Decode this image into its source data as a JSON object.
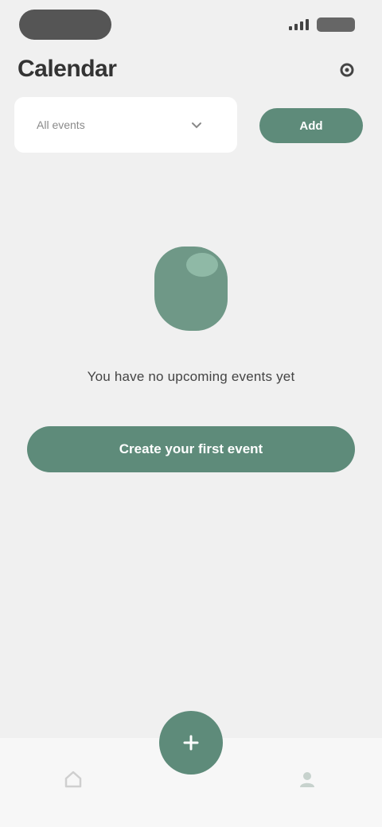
{
  "status_bar": {
    "time": "",
    "icons": [
      "signal-icon",
      "battery-icon"
    ]
  },
  "header": {
    "title": "Calendar",
    "action_icon": "gear-icon"
  },
  "filter": {
    "select_value": "All events",
    "chevron_icon": "chevron-down-icon",
    "button_label": "Add"
  },
  "empty_state": {
    "illustration_icon": "calendar-icon",
    "message": "You have no upcoming events yet",
    "cta_label": "Create your first event"
  },
  "bottom_nav": {
    "left_icon": "home-icon",
    "center_icon": "plus-icon",
    "right_icon": "profile-icon"
  },
  "colors": {
    "accent": "#5e8b7a",
    "background": "#f0f0f0",
    "surface": "#ffffff"
  }
}
